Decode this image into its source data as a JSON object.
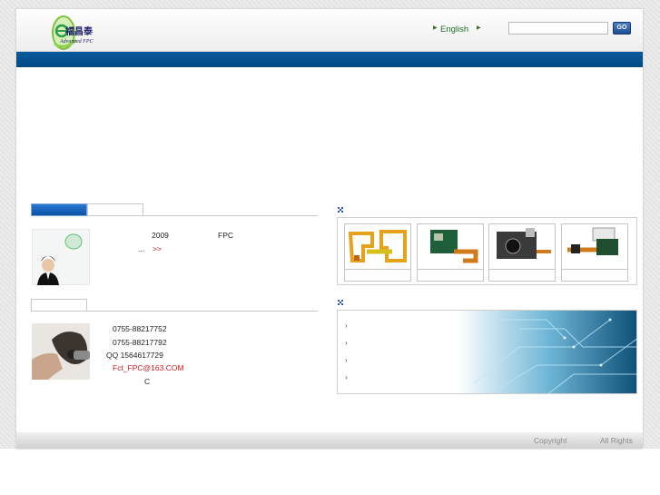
{
  "header": {
    "logo_cn": "福昌泰",
    "logo_en": "Advanced FPC",
    "language_link": "English",
    "search_placeholder": "",
    "search_button": "GO"
  },
  "about": {
    "year": "2009",
    "product": "FPC",
    "ellipsis": "...",
    "more_link": ">>"
  },
  "contact": {
    "phone1": "0755-88217752",
    "phone2": "0755-88217792",
    "qq": "QQ 1564617729",
    "email": "Fct_FPC@163.COM",
    "extra": "C"
  },
  "news": {
    "bullets": [
      "›",
      "›",
      "›",
      "›"
    ]
  },
  "footer": {
    "copyright": "Copyright",
    "rights": "All Rights"
  },
  "colors": {
    "nav_blue": "#004a86",
    "tab_blue": "#0a52a8",
    "link_green": "#1e6e28",
    "email_red": "#cc1a1a"
  },
  "icons": [
    "logo-icon",
    "grid-icon",
    "person-photo",
    "headset-photo",
    "circuit-background"
  ]
}
